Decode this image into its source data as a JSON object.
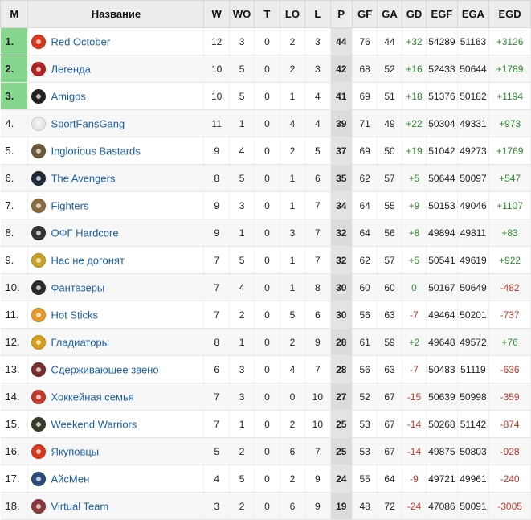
{
  "columns": [
    "M",
    "Название",
    "W",
    "WO",
    "T",
    "LO",
    "L",
    "P",
    "GF",
    "GA",
    "GD",
    "EGF",
    "EGA",
    "EGD"
  ],
  "rows": [
    {
      "pos": "1.",
      "team": "Red October",
      "logo": "team-logo-icon",
      "logo_color": "#d9381e",
      "w": "12",
      "wo": "3",
      "t": "0",
      "lo": "2",
      "l": "3",
      "p": "44",
      "gf": "76",
      "ga": "44",
      "gd": "+32",
      "egf": "54289",
      "ega": "51163",
      "egd": "+3126"
    },
    {
      "pos": "2.",
      "team": "Легенда",
      "logo": "team-logo-icon",
      "logo_color": "#b22222",
      "w": "10",
      "wo": "5",
      "t": "0",
      "lo": "2",
      "l": "3",
      "p": "42",
      "gf": "68",
      "ga": "52",
      "gd": "+16",
      "egf": "52433",
      "ega": "50644",
      "egd": "+1789"
    },
    {
      "pos": "3.",
      "team": "Amigos",
      "logo": "team-logo-icon",
      "logo_color": "#222222",
      "w": "10",
      "wo": "5",
      "t": "0",
      "lo": "1",
      "l": "4",
      "p": "41",
      "gf": "69",
      "ga": "51",
      "gd": "+18",
      "egf": "51376",
      "ega": "50182",
      "egd": "+1194"
    },
    {
      "pos": "4.",
      "team": "SportFansGang",
      "logo": "team-logo-icon",
      "logo_color": "#e8e8e8",
      "w": "11",
      "wo": "1",
      "t": "0",
      "lo": "4",
      "l": "4",
      "p": "39",
      "gf": "71",
      "ga": "49",
      "gd": "+22",
      "egf": "50304",
      "ega": "49331",
      "egd": "+973"
    },
    {
      "pos": "5.",
      "team": "Inglorious Bastards",
      "logo": "team-logo-icon",
      "logo_color": "#6b5a3a",
      "w": "9",
      "wo": "4",
      "t": "0",
      "lo": "2",
      "l": "5",
      "p": "37",
      "gf": "69",
      "ga": "50",
      "gd": "+19",
      "egf": "51042",
      "ega": "49273",
      "egd": "+1769"
    },
    {
      "pos": "6.",
      "team": "The Avengers",
      "logo": "team-logo-icon",
      "logo_color": "#1f2a3a",
      "w": "8",
      "wo": "5",
      "t": "0",
      "lo": "1",
      "l": "6",
      "p": "35",
      "gf": "62",
      "ga": "57",
      "gd": "+5",
      "egf": "50644",
      "ega": "50097",
      "egd": "+547"
    },
    {
      "pos": "7.",
      "team": "Fighters",
      "logo": "team-logo-icon",
      "logo_color": "#8b6b3d",
      "w": "9",
      "wo": "3",
      "t": "0",
      "lo": "1",
      "l": "7",
      "p": "34",
      "gf": "64",
      "ga": "55",
      "gd": "+9",
      "egf": "50153",
      "ega": "49046",
      "egd": "+1107"
    },
    {
      "pos": "8.",
      "team": "ОФГ Hardcore",
      "logo": "team-logo-icon",
      "logo_color": "#333333",
      "w": "9",
      "wo": "1",
      "t": "0",
      "lo": "3",
      "l": "7",
      "p": "32",
      "gf": "64",
      "ga": "56",
      "gd": "+8",
      "egf": "49894",
      "ega": "49811",
      "egd": "+83"
    },
    {
      "pos": "9.",
      "team": "Нас не догонят",
      "logo": "team-logo-icon",
      "logo_color": "#c9a227",
      "w": "7",
      "wo": "5",
      "t": "0",
      "lo": "1",
      "l": "7",
      "p": "32",
      "gf": "62",
      "ga": "57",
      "gd": "+5",
      "egf": "50541",
      "ega": "49619",
      "egd": "+922"
    },
    {
      "pos": "10.",
      "team": "Фантазеры",
      "logo": "team-logo-icon",
      "logo_color": "#2a2a2a",
      "w": "7",
      "wo": "4",
      "t": "0",
      "lo": "1",
      "l": "8",
      "p": "30",
      "gf": "60",
      "ga": "60",
      "gd": "0",
      "egf": "50167",
      "ega": "50649",
      "egd": "-482"
    },
    {
      "pos": "11.",
      "team": "Hot Sticks",
      "logo": "team-logo-icon",
      "logo_color": "#e59a2a",
      "w": "7",
      "wo": "2",
      "t": "0",
      "lo": "5",
      "l": "6",
      "p": "30",
      "gf": "56",
      "ga": "63",
      "gd": "-7",
      "egf": "49464",
      "ega": "50201",
      "egd": "-737"
    },
    {
      "pos": "12.",
      "team": "Гладиаторы",
      "logo": "team-logo-icon",
      "logo_color": "#d4a017",
      "w": "8",
      "wo": "1",
      "t": "0",
      "lo": "2",
      "l": "9",
      "p": "28",
      "gf": "61",
      "ga": "59",
      "gd": "+2",
      "egf": "49648",
      "ega": "49572",
      "egd": "+76"
    },
    {
      "pos": "13.",
      "team": "Сдерживающее звено",
      "logo": "team-logo-icon",
      "logo_color": "#7a2e2e",
      "w": "6",
      "wo": "3",
      "t": "0",
      "lo": "4",
      "l": "7",
      "p": "28",
      "gf": "56",
      "ga": "63",
      "gd": "-7",
      "egf": "50483",
      "ega": "51119",
      "egd": "-636"
    },
    {
      "pos": "14.",
      "team": "Хоккейная семья",
      "logo": "team-logo-icon",
      "logo_color": "#c0392b",
      "w": "7",
      "wo": "3",
      "t": "0",
      "lo": "0",
      "l": "10",
      "p": "27",
      "gf": "52",
      "ga": "67",
      "gd": "-15",
      "egf": "50639",
      "ega": "50998",
      "egd": "-359"
    },
    {
      "pos": "15.",
      "team": "Weekend Warriors",
      "logo": "team-logo-icon",
      "logo_color": "#3a3a2a",
      "w": "7",
      "wo": "1",
      "t": "0",
      "lo": "2",
      "l": "10",
      "p": "25",
      "gf": "53",
      "ga": "67",
      "gd": "-14",
      "egf": "50268",
      "ega": "51142",
      "egd": "-874"
    },
    {
      "pos": "16.",
      "team": "Якуповцы",
      "logo": "team-logo-icon",
      "logo_color": "#d9381e",
      "w": "5",
      "wo": "2",
      "t": "0",
      "lo": "6",
      "l": "7",
      "p": "25",
      "gf": "53",
      "ga": "67",
      "gd": "-14",
      "egf": "49875",
      "ega": "50803",
      "egd": "-928"
    },
    {
      "pos": "17.",
      "team": "АйсМен",
      "logo": "team-logo-icon",
      "logo_color": "#2c4a7a",
      "w": "4",
      "wo": "5",
      "t": "0",
      "lo": "2",
      "l": "9",
      "p": "24",
      "gf": "55",
      "ga": "64",
      "gd": "-9",
      "egf": "49721",
      "ega": "49961",
      "egd": "-240"
    },
    {
      "pos": "18.",
      "team": "Virtual Team",
      "logo": "team-logo-icon",
      "logo_color": "#8a3a3a",
      "w": "3",
      "wo": "2",
      "t": "0",
      "lo": "6",
      "l": "9",
      "p": "19",
      "gf": "48",
      "ga": "72",
      "gd": "-24",
      "egf": "47086",
      "ega": "50091",
      "egd": "-3005"
    }
  ]
}
